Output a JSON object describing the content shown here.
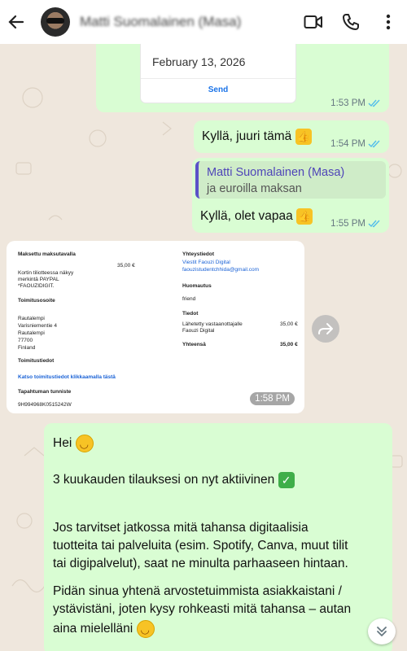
{
  "header": {
    "contact_name": "Matti Suomalainen (Masa)",
    "icons": [
      "back-arrow-icon",
      "video-call-icon",
      "phone-icon",
      "more-vert-icon"
    ]
  },
  "messages": {
    "card": {
      "date": "February 13, 2026",
      "send_label": "Send",
      "time": "1:53 PM"
    },
    "m2": {
      "text": "Kyllä, juuri tämä",
      "time": "1:54 PM"
    },
    "m3": {
      "quote_name": "Matti Suomalainen (Masa)",
      "quote_text": "ja euroilla maksan",
      "text": "Kyllä, olet vapaa",
      "time": "1:55 PM"
    },
    "receipt": {
      "time": "1:58 PM",
      "left": {
        "paid_heading": "Maksettu maksutavalla",
        "amount": "35,00 €",
        "statement_note": "Kortin tiliotteessa näkyy",
        "statement_mark": "merkintä PAYPAL",
        "statement_mark2": "*FAOUZIDIGIT.",
        "delivery_heading": "Toimitusosoite",
        "addr1": "Rautalempi",
        "addr2": "Varisniementie 4",
        "addr3": "Rautalempi",
        "addr4": "77700",
        "addr5": "Finland",
        "shipping_heading": "Toimitustiedot",
        "shipping_link": "Katso toimitustiedot klikkaamalla tästä",
        "tx_heading": "Tapahtuman tunniste",
        "tx_id": "9H994968K0515242W"
      },
      "right": {
        "contact_heading": "Yhteystiedot",
        "contact_name": "Viestit Faouzi Digital",
        "contact_email": "faouzistudentchhida@gmail.com",
        "note_heading": "Huomautus",
        "note_text": "friend",
        "details_heading": "Tiedot",
        "details_item": "Lähetetty vastaanottajalle",
        "details_item2": "Faouzi Digital",
        "details_amount": "35,00 €",
        "total_label": "Yhteensä",
        "total_amount": "35,00 €"
      }
    },
    "long": {
      "l1": "Hei",
      "l2": "3 kuukauden tilauksesi on nyt aktiivinen",
      "l3": "Jos tarvitset jatkossa mitä tahansa digitaalisia",
      "l4": "tuotteita tai palveluita (esim. Spotify, Canva, muut tilit",
      "l5": "tai digipalvelut), saat ne minulta parhaaseen hintaan.",
      "l6": "Pidän sinua yhtenä arvostetuimmista asiakkaistani /",
      "l7": "ystävistäni, joten kysy rohkeasti mitä tahansa – autan",
      "l8": "aina mielelläni"
    }
  },
  "colors": {
    "outgoing_bubble": "#d9fdd3",
    "incoming_bubble": "#ffffff",
    "chat_bg": "#efe7dd",
    "read_ticks": "#53bdeb"
  }
}
